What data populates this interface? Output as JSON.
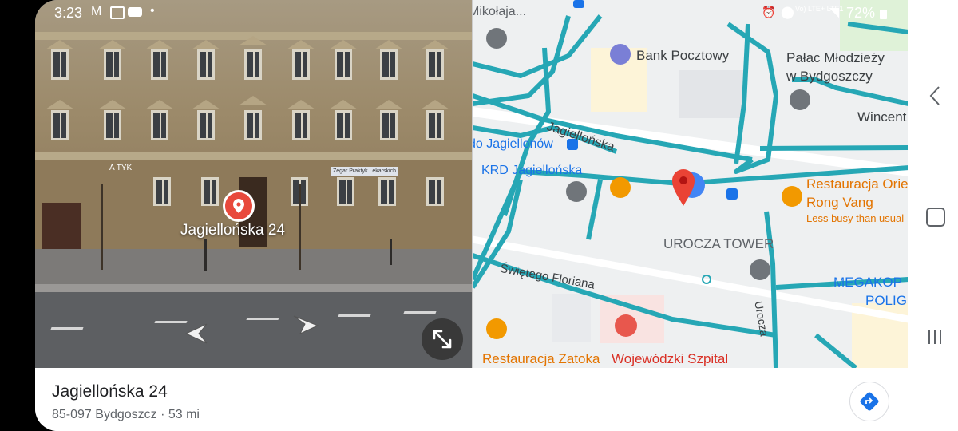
{
  "status_bar": {
    "time": "3:23",
    "network": "Vo) LTE+ LTE1",
    "battery": "72%"
  },
  "street_view": {
    "caption": "Jagiellońska 24",
    "shop_signs": [
      "A TYKI",
      "Zegar Praktyk Lekarskich"
    ]
  },
  "map": {
    "labels": {
      "mikolaja": "Mikołaja...",
      "bank": "Bank Pocztowy",
      "palace_line1": "Pałac Młodzieży",
      "palace_line2": "w Bydgoszczy",
      "wincent": "Wincent",
      "jagiellonska_street": "Jagiellońska",
      "stop_name": "do Jagiellonów",
      "krd": "KRD Jagiellońska",
      "restaurant_orient": "Restauracja Orie",
      "rong_vang": "Rong Vang",
      "less_busy": "Less busy than usual",
      "tower": "UROCZA TOWER",
      "megakop_line1": "MEGAKOP",
      "megakop_line2": "POLIG",
      "swietego": "Świętego Floriana",
      "urocza": "Urocza",
      "restaurant_zatoka": "Restauracja Zatoka",
      "hospital": "Wojewódzki Szpital"
    },
    "colors": {
      "transit": "#26a7b5",
      "pin": "#ea4335",
      "restaurant": "#f29900",
      "hospital": "#d93025",
      "poi": "#70757a"
    }
  },
  "place": {
    "title": "Jagiellońska 24",
    "subtitle": "85-097 Bydgoszcz · 53 mi"
  }
}
